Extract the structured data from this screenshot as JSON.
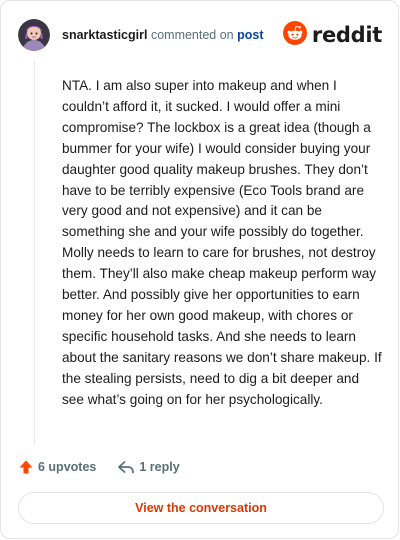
{
  "header": {
    "username": "snarktasticgirl",
    "action_text": "commented on",
    "post_link": "post",
    "brand": "reddit"
  },
  "comment": {
    "text": "NTA. I am also super into makeup and when I couldn’t afford it, it sucked. I would offer a mini compromise? The lockbox is a great idea (though a bummer for your wife) I would consider buying your daughter good quality makeup brushes. They don’t have to be terribly expensive (Eco Tools brand are very good and not expensive) and it can be something she and your wife possibly do together. Molly needs to learn to care for brushes, not destroy them. They’ll also make cheap makeup perform way better. And possibly give her opportunities to earn money for her own good makeup, with chores or specific household tasks. And she needs to learn about the sanitary reasons we don’t share makeup. If the stealing persists, need to dig a bit deeper and see what’s going on for her psychologically."
  },
  "actions": {
    "upvotes": "6 upvotes",
    "replies": "1 reply"
  },
  "cta": {
    "label": "View the conversation"
  },
  "icons": {
    "avatar": "avatar",
    "logo": "reddit-logo-icon",
    "upvote": "upvote-arrow-icon",
    "reply": "reply-arrow-icon"
  },
  "colors": {
    "reddit_orange": "#ff4500",
    "upvote_orange": "#d93900",
    "link_blue": "#0a449b",
    "meta_gray": "#576f76",
    "text": "#1c1c1c",
    "border": "#e3e5e8"
  }
}
